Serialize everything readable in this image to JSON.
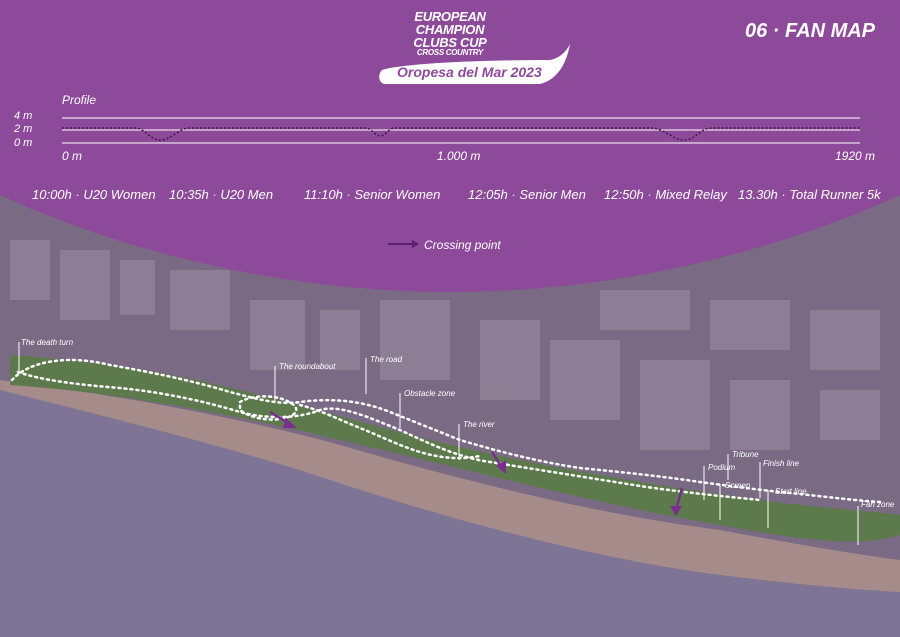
{
  "header": {
    "logo": [
      "EUROPEAN",
      "CHAMPION",
      "CLUBS CUP",
      "CROSS COUNTRY"
    ],
    "location": "Oropesa del Mar 2023",
    "title": "06 · FAN MAP"
  },
  "profile": {
    "label": "Profile",
    "y_ticks": [
      "4 m",
      "2 m",
      "0 m"
    ],
    "x_ticks": [
      "0 m",
      "1.000 m",
      "1920 m"
    ]
  },
  "schedule": [
    "10:00h · U20 Women",
    "10:35h · U20 Men",
    "11:10h · Senior Women",
    "12:05h · Senior Men",
    "12:50h · Mixed Relay",
    "13.30h · Total Runner 5k"
  ],
  "legend": {
    "crossing_point": "Crossing point"
  },
  "map_labels": {
    "death_turn": "The death turn",
    "roundabout": "The roundabout",
    "road": "The road",
    "obstacle_zone": "Obstacle zone",
    "river": "The river",
    "tribune": "Tribune",
    "podium": "Podium",
    "finish_line": "Finish line",
    "screen": "Screen",
    "start_line": "Start line",
    "fan_zone": "Fan zone"
  },
  "colors": {
    "header_purple": "#8e4a9a",
    "arrow_purple": "#7a2e8e",
    "sea": "#7d7496",
    "beach": "#a58c8a",
    "park": "#5d7a4c"
  }
}
